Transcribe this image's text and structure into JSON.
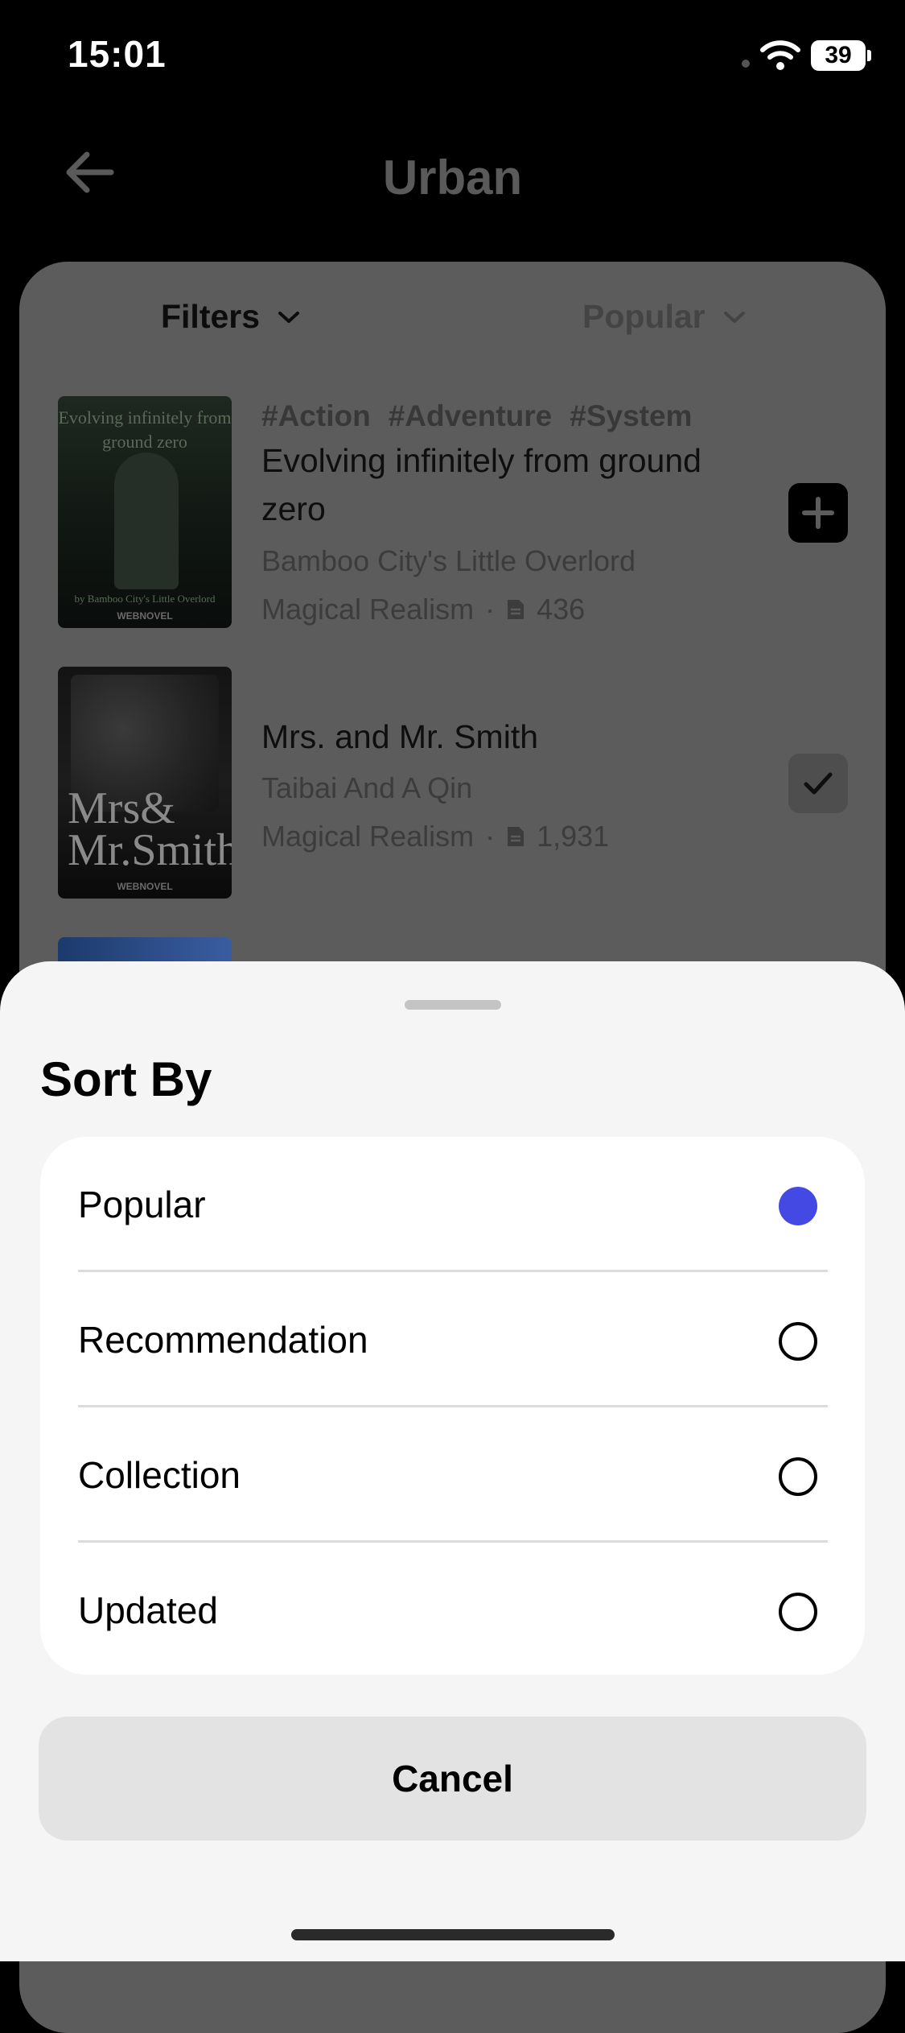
{
  "status_bar": {
    "time": "15:01",
    "battery": "39"
  },
  "header": {
    "title": "Urban",
    "back_icon": "arrow-left-icon"
  },
  "toolbar": {
    "filters_label": "Filters",
    "sort_label": "Popular"
  },
  "books": [
    {
      "tags": [
        "#Action",
        "#Adventure",
        "#System"
      ],
      "title": "Evolving infinitely from ground zero",
      "author": "Bamboo City's Little Overlord",
      "genre": "Magical Realism",
      "chapters": "436",
      "action_icon": "plus-icon",
      "cover_title": "Evolving infinitely from ground zero",
      "cover_author": "by Bamboo City's Little Overlord",
      "cover_brand": "WEBNOVEL"
    },
    {
      "tags": [],
      "title": "Mrs. and Mr. Smith",
      "author": "Taibai And A Qin",
      "genre": "Magical Realism",
      "chapters": "1,931",
      "action_icon": "check-icon",
      "cover_title": "Mrs& Mr.Smith",
      "cover_brand": "WEBNOVEL"
    }
  ],
  "meta_separator": "·",
  "sheet": {
    "title": "Sort By",
    "options": [
      {
        "label": "Popular",
        "selected": true
      },
      {
        "label": "Recommendation",
        "selected": false
      },
      {
        "label": "Collection",
        "selected": false
      },
      {
        "label": "Updated",
        "selected": false
      }
    ],
    "cancel_label": "Cancel"
  },
  "colors": {
    "accent": "#4549e4",
    "sheet_bg": "#f5f5f5",
    "card_bg": "#ffffff",
    "cancel_bg": "#e3e3e3"
  }
}
